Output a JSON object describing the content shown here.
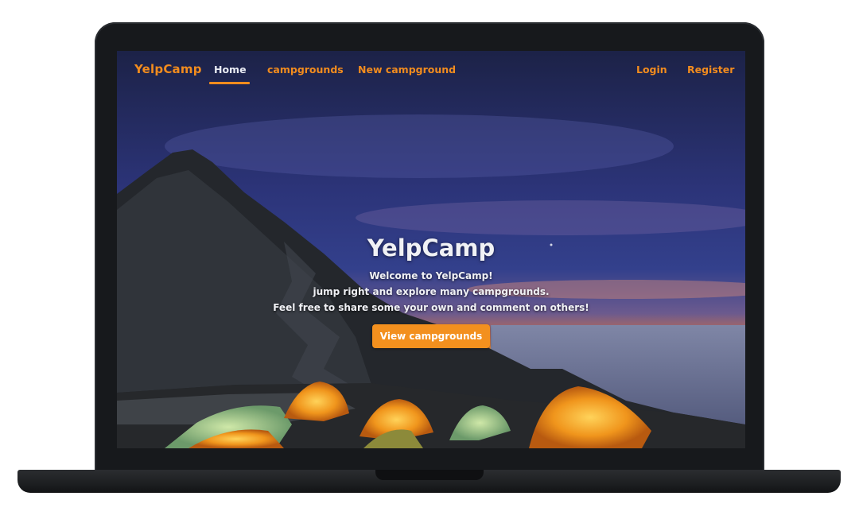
{
  "navbar": {
    "brand": "YelpCamp",
    "links": [
      {
        "label": "Home",
        "active": true
      },
      {
        "label": "campgrounds",
        "active": false
      },
      {
        "label": "New campground",
        "active": false
      }
    ],
    "auth": [
      {
        "label": "Login"
      },
      {
        "label": "Register"
      }
    ]
  },
  "hero": {
    "title": "YelpCamp",
    "lines": [
      "Welcome to YelpCamp!",
      "jump right and explore many campgrounds.",
      "Feel free to share some your own and comment on others!"
    ],
    "button_label": "View campgrounds"
  },
  "colors": {
    "accent": "#f28c1e",
    "nav_active_text": "#e8ebf3",
    "device_frame": "#17191c"
  }
}
